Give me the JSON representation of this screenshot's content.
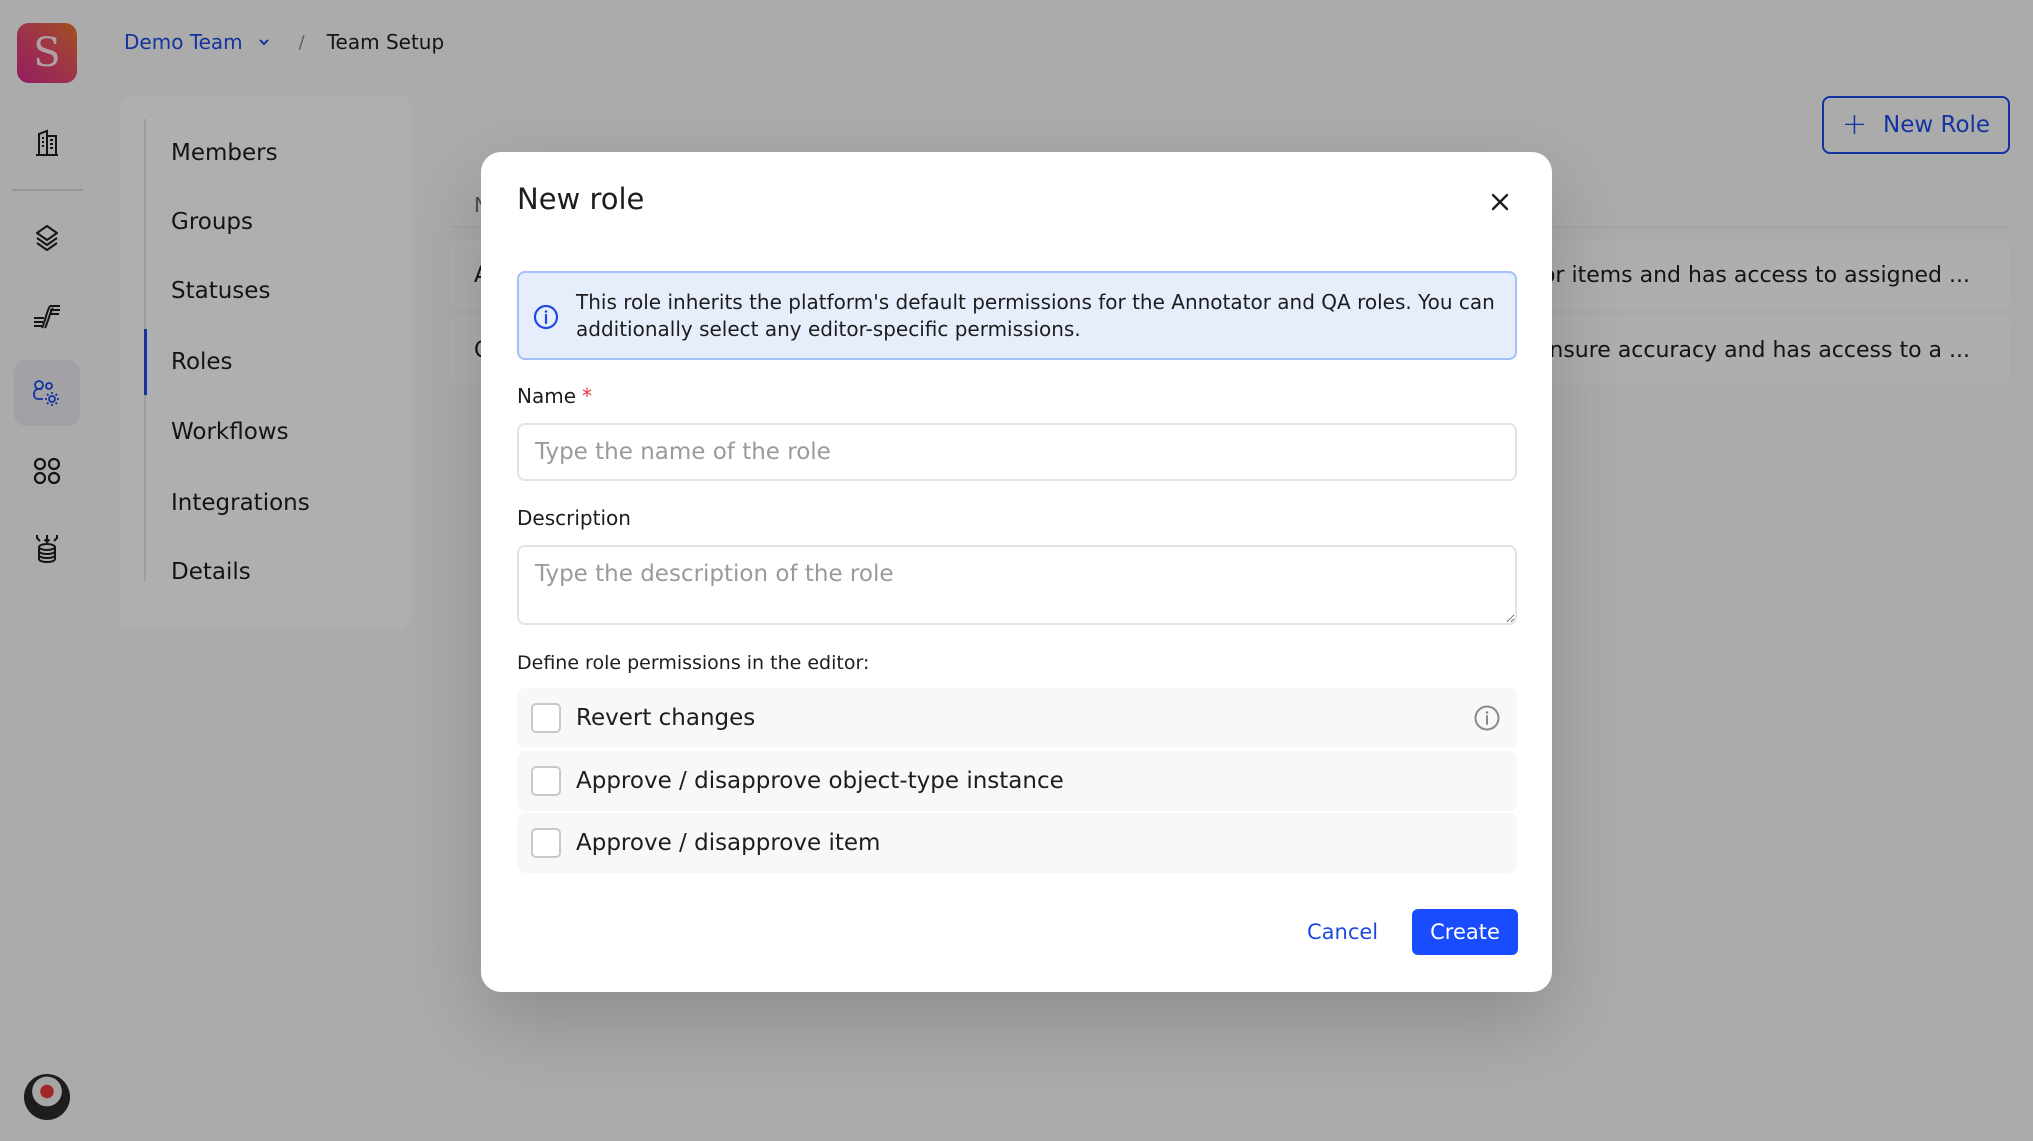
{
  "app": {
    "logo_letter": "S",
    "rail_icons": [
      {
        "name": "organization-building-icon",
        "active": false
      },
      {
        "name": "layers-icon",
        "active": false
      },
      {
        "name": "pipeline-icon",
        "active": false
      },
      {
        "name": "team-settings-icon",
        "active": true
      },
      {
        "name": "apps-grid-icon",
        "active": false
      },
      {
        "name": "data-import-icon",
        "active": false
      }
    ]
  },
  "breadcrumb": {
    "team": "Demo Team",
    "separator": "/",
    "current": "Team Setup"
  },
  "settings_nav": {
    "items": [
      {
        "label": "Members",
        "active": false
      },
      {
        "label": "Groups",
        "active": false
      },
      {
        "label": "Statuses",
        "active": false
      },
      {
        "label": "Roles",
        "active": true
      },
      {
        "label": "Workflows",
        "active": false
      },
      {
        "label": "Integrations",
        "active": false
      },
      {
        "label": "Details",
        "active": false
      }
    ]
  },
  "roles_page": {
    "new_role_label": "New Role",
    "table_header_partial": "N",
    "rows": [
      {
        "name_partial": "A",
        "desc_partial": "or items and has access to assigned ..."
      },
      {
        "name_partial": "Q",
        "desc_partial": "nsure accuracy and has access to a ..."
      }
    ]
  },
  "modal": {
    "title": "New role",
    "info_text": "This role inherits the platform's default permissions for the Annotator and QA roles. You can additionally select any editor-specific permissions.",
    "name_label": "Name",
    "name_required_mark": "*",
    "name_value": "",
    "name_placeholder": "Type the name of the role",
    "description_label": "Description",
    "description_value": "",
    "description_placeholder": "Type the description of the role",
    "permissions_label": "Define role permissions in the editor:",
    "permissions": [
      {
        "label": "Revert changes",
        "checked": false,
        "has_info": true
      },
      {
        "label": "Approve / disapprove object-type instance",
        "checked": false,
        "has_info": false
      },
      {
        "label": "Approve / disapprove item",
        "checked": false,
        "has_info": false
      }
    ],
    "cancel_label": "Cancel",
    "create_label": "Create"
  },
  "colors": {
    "accent": "#1e49e2",
    "primary_button": "#1a4cff",
    "info_bg": "#e6eefc",
    "info_border": "#a4c1f7",
    "required": "#e53935"
  }
}
